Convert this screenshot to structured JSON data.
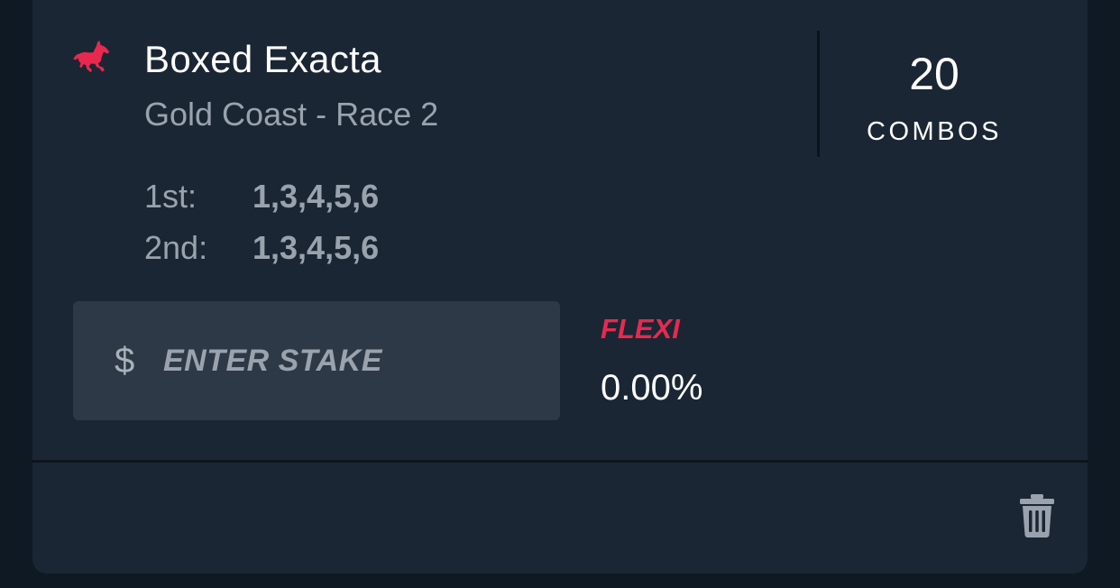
{
  "bet": {
    "title": "Boxed Exacta",
    "subtitle": "Gold Coast - Race 2",
    "icon": "horse-icon"
  },
  "combos": {
    "count": "20",
    "label": "COMBOS"
  },
  "selections": [
    {
      "label": "1st:",
      "value": "1,3,4,5,6"
    },
    {
      "label": "2nd:",
      "value": "1,3,4,5,6"
    }
  ],
  "stake": {
    "currency_symbol": "$",
    "placeholder": "ENTER STAKE",
    "value": ""
  },
  "flexi": {
    "label": "FLEXI",
    "value": "0.00%"
  },
  "actions": {
    "delete_icon": "trash-icon"
  },
  "colors": {
    "accent": "#e8294f",
    "card_background": "#1b2634",
    "page_background": "#0f1923",
    "input_background": "#2e3947",
    "muted_text": "#9aa3ad"
  }
}
